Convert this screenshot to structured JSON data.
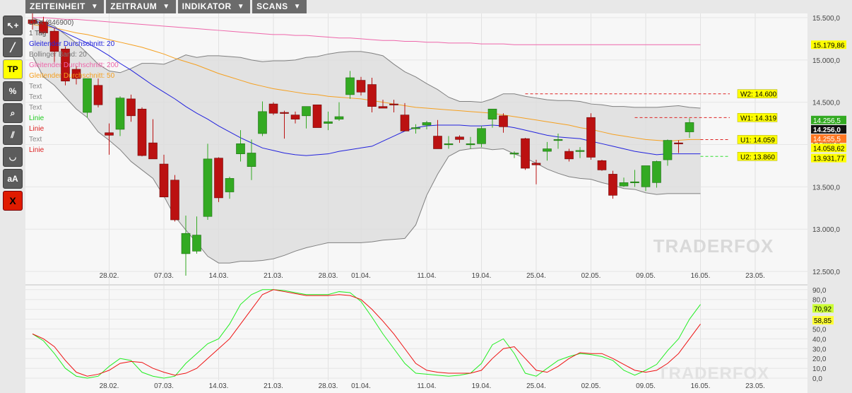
{
  "menu": [
    {
      "label": "ZEITEINHEIT",
      "name": "menu-zeiteinheit"
    },
    {
      "label": "ZEITRAUM",
      "name": "menu-zeitraum"
    },
    {
      "label": "INDIKATOR",
      "name": "menu-indikator"
    },
    {
      "label": "SCANS",
      "name": "menu-scans"
    }
  ],
  "tools": [
    {
      "name": "pointer-add-tool",
      "glyph": "↖+",
      "style": "grey"
    },
    {
      "name": "line-tool",
      "glyph": "╱",
      "style": "grey"
    },
    {
      "name": "tp-tool",
      "glyph": "TP",
      "style": "yellow"
    },
    {
      "name": "percent-tool",
      "glyph": "%",
      "style": "grey"
    },
    {
      "name": "zoom-tool",
      "glyph": "⌕",
      "style": "grey"
    },
    {
      "name": "parallel-lines-tool",
      "glyph": "⫽",
      "style": "grey"
    },
    {
      "name": "curve-tool",
      "glyph": "◡",
      "style": "grey"
    },
    {
      "name": "text-size-tool",
      "glyph": "aA",
      "style": "grey"
    },
    {
      "name": "delete-tool",
      "glyph": "X",
      "style": "red"
    }
  ],
  "colors": {
    "up": "#33aa22",
    "down": "#bb1111",
    "bollinger": "#808080",
    "ma20": "#2222dd",
    "ma50": "#f5a020",
    "ma200": "#ee66aa",
    "stoch_k": "#22ee22",
    "stoch_d": "#ee1111",
    "hline_red": "#dd2222",
    "hline_green": "#33dd33"
  },
  "legend": [
    {
      "text": "DAX (846900)",
      "color": "#555555"
    },
    {
      "text": "1 Tag",
      "color": "#555555"
    },
    {
      "text": "Gleitender Durchschnitt: 20",
      "color": "#2222dd"
    },
    {
      "text": "Bollinger Band: 20",
      "color": "#777777"
    },
    {
      "text": "Gleitender Durchschnitt: 200",
      "color": "#ee66aa"
    },
    {
      "text": "Gleitender Durchschnitt: 50",
      "color": "#f5a020"
    },
    {
      "text": "Text",
      "color": "#888888"
    },
    {
      "text": "Text",
      "color": "#888888"
    },
    {
      "text": "Text",
      "color": "#888888"
    },
    {
      "text": "Linie",
      "color": "#22cc22"
    },
    {
      "text": "Linie",
      "color": "#dd2222"
    },
    {
      "text": "Text",
      "color": "#888888"
    },
    {
      "text": "Linie",
      "color": "#dd2222"
    }
  ],
  "watermark": "TRADERFOX",
  "chart_data": [
    {
      "type": "candlestick",
      "title": "DAX (846900)",
      "ylim": [
        12350,
        15550
      ],
      "yticks": [
        "15.500,0",
        "15.000,0",
        "14.500,0",
        "14.000,0",
        "13.500,0",
        "13.000,0",
        "12.500,0"
      ],
      "ytick_values": [
        15500,
        15000,
        14500,
        14000,
        13500,
        13000,
        12500
      ],
      "xticks": [
        "28.02.",
        "07.03.",
        "14.03.",
        "21.03.",
        "28.03.",
        "01.04.",
        "11.04.",
        "19.04.",
        "25.04.",
        "02.05.",
        "09.05.",
        "16.05.",
        "23.05."
      ],
      "xtick_index": [
        7,
        12,
        17,
        22,
        27,
        30,
        36,
        41,
        46,
        51,
        56,
        61,
        66
      ],
      "candles": [
        [
          15475,
          15550,
          15360,
          15430
        ],
        [
          15450,
          15510,
          15310,
          15320
        ],
        [
          15340,
          15380,
          14960,
          15100
        ],
        [
          15130,
          15160,
          14700,
          14750
        ],
        [
          14890,
          14930,
          14710,
          14780
        ],
        [
          14380,
          14600,
          14320,
          14780
        ],
        [
          14700,
          14780,
          14440,
          14470
        ],
        [
          14140,
          14250,
          13880,
          14110
        ],
        [
          14180,
          14570,
          14100,
          14550
        ],
        [
          14540,
          14590,
          14270,
          14340
        ],
        [
          14420,
          14440,
          13860,
          13870
        ],
        [
          14020,
          14300,
          13840,
          13830
        ],
        [
          13770,
          13880,
          13390,
          13380
        ],
        [
          13580,
          13640,
          13090,
          13110
        ],
        [
          12710,
          13160,
          12450,
          12950
        ],
        [
          12740,
          13150,
          12710,
          12930
        ],
        [
          13150,
          14010,
          13110,
          13830
        ],
        [
          13840,
          13850,
          13320,
          13370
        ],
        [
          13440,
          13620,
          13360,
          13600
        ],
        [
          13890,
          14170,
          13800,
          14010
        ],
        [
          13740,
          14060,
          13580,
          13900
        ],
        [
          14130,
          14510,
          14100,
          14390
        ],
        [
          14480,
          14500,
          14350,
          14370
        ],
        [
          14380,
          14400,
          14070,
          14370
        ],
        [
          14350,
          14390,
          14250,
          14300
        ],
        [
          14340,
          14450,
          14190,
          14450
        ],
        [
          14470,
          14470,
          14290,
          14200
        ],
        [
          14250,
          14390,
          14170,
          14270
        ],
        [
          14300,
          14500,
          14280,
          14330
        ],
        [
          14590,
          14870,
          14540,
          14790
        ],
        [
          14760,
          14800,
          14580,
          14620
        ],
        [
          14710,
          14790,
          14380,
          14450
        ],
        [
          14450,
          14530,
          14430,
          14430
        ],
        [
          14480,
          14530,
          14380,
          14470
        ],
        [
          14350,
          14490,
          14250,
          14160
        ],
        [
          14200,
          14240,
          14130,
          14200
        ],
        [
          14230,
          14280,
          14180,
          14260
        ],
        [
          14100,
          14290,
          14000,
          13950
        ],
        [
          14000,
          14100,
          13950,
          14010
        ],
        [
          14090,
          14110,
          14020,
          14060
        ],
        [
          14010,
          14090,
          13950,
          14010
        ],
        [
          14010,
          14220,
          13970,
          14190
        ],
        [
          14300,
          14410,
          14200,
          14420
        ],
        [
          14340,
          14370,
          14140,
          14210
        ],
        [
          13900,
          13920,
          13840,
          13900
        ],
        [
          14070,
          14080,
          13700,
          13720
        ],
        [
          13780,
          13820,
          13530,
          13760
        ],
        [
          13920,
          14030,
          13810,
          13950
        ],
        [
          14050,
          14130,
          13950,
          14060
        ],
        [
          13920,
          13950,
          13800,
          13830
        ],
        [
          13930,
          13970,
          13840,
          13930
        ],
        [
          14320,
          14370,
          13820,
          13850
        ],
        [
          13810,
          13820,
          13690,
          13700
        ],
        [
          13650,
          13690,
          13360,
          13400
        ],
        [
          13510,
          13610,
          13500,
          13550
        ],
        [
          13550,
          13700,
          13500,
          13560
        ],
        [
          13500,
          13710,
          13450,
          13750
        ],
        [
          13550,
          13810,
          13490,
          13800
        ],
        [
          13820,
          14060,
          13750,
          14050
        ],
        [
          14020,
          14050,
          13900,
          14010
        ],
        [
          14150,
          14310,
          14080,
          14260
        ]
      ],
      "bollinger_upper": [
        15500,
        15450,
        15400,
        15300,
        15200,
        15080,
        14950,
        14870,
        14850,
        14900,
        14960,
        14960,
        14950,
        15000,
        15060,
        15030,
        15050,
        15050,
        15040,
        15030,
        15000,
        14980,
        14990,
        14990,
        15000,
        15030,
        15040,
        15070,
        15090,
        15100,
        15100,
        15080,
        15050,
        14950,
        14860,
        14800,
        14720,
        14650,
        14560,
        14510,
        14510,
        14500,
        14540,
        14600,
        14600,
        14570,
        14550,
        14530,
        14520,
        14520,
        14510,
        14480,
        14470,
        14450,
        14450,
        14440,
        14440,
        14440,
        14450,
        14460,
        14440,
        14430
      ],
      "bollinger_lower": [
        15050,
        14800,
        14700,
        14560,
        14420,
        14320,
        14150,
        14050,
        13940,
        13800,
        13700,
        13600,
        13390,
        13150,
        12990,
        12840,
        12680,
        12600,
        12600,
        12620,
        12620,
        12630,
        12650,
        12690,
        12740,
        12780,
        12810,
        12840,
        12840,
        12840,
        12840,
        12850,
        12870,
        12880,
        12890,
        13050,
        13400,
        13650,
        13860,
        13930,
        13950,
        13960,
        13940,
        13950,
        13890,
        13840,
        13780,
        13710,
        13660,
        13620,
        13600,
        13590,
        13550,
        13520,
        13480,
        13470,
        13430,
        13410,
        13420,
        13420,
        13420,
        13420
      ],
      "ma20": [
        15470,
        15430,
        15380,
        15320,
        15260,
        15200,
        15130,
        15050,
        14960,
        14880,
        14790,
        14700,
        14620,
        14540,
        14450,
        14370,
        14300,
        14220,
        14150,
        14080,
        14020,
        13960,
        13930,
        13900,
        13880,
        13870,
        13880,
        13890,
        13920,
        13940,
        13960,
        13980,
        14040,
        14100,
        14160,
        14200,
        14220,
        14230,
        14230,
        14230,
        14220,
        14220,
        14230,
        14220,
        14200,
        14170,
        14140,
        14110,
        14090,
        14080,
        14070,
        14040,
        14010,
        13980,
        13950,
        13920,
        13900,
        13880,
        13890,
        13890,
        13890,
        13890
      ],
      "ma50": [
        15420,
        15400,
        15380,
        15350,
        15320,
        15300,
        15270,
        15240,
        15210,
        15180,
        15150,
        15110,
        15070,
        15020,
        14980,
        14940,
        14890,
        14840,
        14800,
        14760,
        14720,
        14690,
        14660,
        14640,
        14620,
        14600,
        14590,
        14570,
        14560,
        14550,
        14540,
        14520,
        14500,
        14480,
        14460,
        14440,
        14430,
        14420,
        14410,
        14400,
        14390,
        14380,
        14370,
        14350,
        14330,
        14310,
        14290,
        14270,
        14250,
        14230,
        14200,
        14180,
        14150,
        14120,
        14100,
        14080,
        14060,
        14050,
        14040,
        14050,
        14060,
        14060
      ],
      "ma200": [
        15500,
        15500,
        15490,
        15480,
        15480,
        15470,
        15460,
        15450,
        15440,
        15430,
        15420,
        15410,
        15400,
        15390,
        15380,
        15370,
        15360,
        15350,
        15340,
        15330,
        15320,
        15310,
        15300,
        15300,
        15290,
        15290,
        15280,
        15270,
        15260,
        15260,
        15250,
        15240,
        15230,
        15230,
        15220,
        15220,
        15210,
        15210,
        15200,
        15200,
        15200,
        15190,
        15190,
        15190,
        15180,
        15180,
        15180,
        15180,
        15180,
        15180,
        15180,
        15180,
        15180,
        15180,
        15180,
        15180,
        15180,
        15180,
        15180,
        15180,
        15180,
        15180
      ],
      "hlines": [
        {
          "label": "W2: 14.600",
          "value": 14600,
          "color": "#dd2222",
          "from": 45
        },
        {
          "label": "W1: 14.319",
          "value": 14319,
          "color": "#dd2222",
          "from": 55
        },
        {
          "label": "U1: 14.059",
          "value": 14059,
          "color": "#dd2222",
          "from": 61
        },
        {
          "label": "U2: 13.860",
          "value": 13860,
          "color": "#33dd33",
          "from": 61
        }
      ],
      "price_tags": [
        {
          "text": "15.179,86",
          "value": 15180,
          "bg": "#ffff00",
          "fg": "#000000"
        },
        {
          "text": "14.256,5",
          "value": 14290,
          "bg": "#33aa22",
          "fg": "#ffffff"
        },
        {
          "text": "14.256,0",
          "value": 14180,
          "bg": "#111111",
          "fg": "#ffffff"
        },
        {
          "text": "14.255,5",
          "value": 14070,
          "bg": "#ff7722",
          "fg": "#ffffff"
        },
        {
          "text": "14.058,62",
          "value": 13960,
          "bg": "#ffff00",
          "fg": "#000000"
        },
        {
          "text": "13.931,77",
          "value": 13840,
          "bg": "#ffff00",
          "fg": "#000000"
        }
      ]
    },
    {
      "type": "line",
      "title": "",
      "ylim": [
        0,
        92
      ],
      "yticks": [
        "90,0",
        "80,0",
        "70,0",
        "60,0",
        "50,0",
        "40,0",
        "30,0",
        "20,0",
        "10,0",
        "0,0"
      ],
      "ytick_values": [
        90,
        80,
        70,
        60,
        50,
        40,
        30,
        20,
        10,
        0
      ],
      "series": [
        {
          "name": "",
          "color": "#22ee22",
          "values": [
            45,
            38,
            25,
            10,
            2,
            0,
            2,
            12,
            20,
            18,
            6,
            2,
            0,
            2,
            15,
            25,
            35,
            40,
            55,
            75,
            85,
            90,
            90,
            89,
            87,
            85,
            85,
            85,
            88,
            87,
            78,
            62,
            45,
            30,
            15,
            5,
            4,
            3,
            2,
            3,
            5,
            15,
            34,
            40,
            25,
            5,
            2,
            10,
            18,
            22,
            25,
            24,
            22,
            18,
            8,
            3,
            8,
            14,
            28,
            40,
            60,
            75
          ]
        },
        {
          "name": "",
          "color": "#ee1111",
          "values": [
            45,
            40,
            32,
            18,
            6,
            2,
            4,
            8,
            15,
            17,
            16,
            10,
            6,
            3,
            5,
            10,
            20,
            30,
            40,
            55,
            70,
            85,
            90,
            88,
            86,
            84,
            84,
            84,
            85,
            84,
            80,
            70,
            58,
            45,
            30,
            15,
            8,
            6,
            5,
            5,
            5,
            8,
            20,
            30,
            32,
            20,
            8,
            6,
            12,
            20,
            26,
            25,
            25,
            20,
            14,
            8,
            6,
            8,
            15,
            25,
            40,
            55
          ]
        }
      ],
      "value_tags": [
        {
          "text": "70,92",
          "value": 70.92,
          "bg": "#ccff33"
        },
        {
          "text": "58,85",
          "value": 58.85,
          "bg": "#ffff33"
        }
      ]
    }
  ]
}
